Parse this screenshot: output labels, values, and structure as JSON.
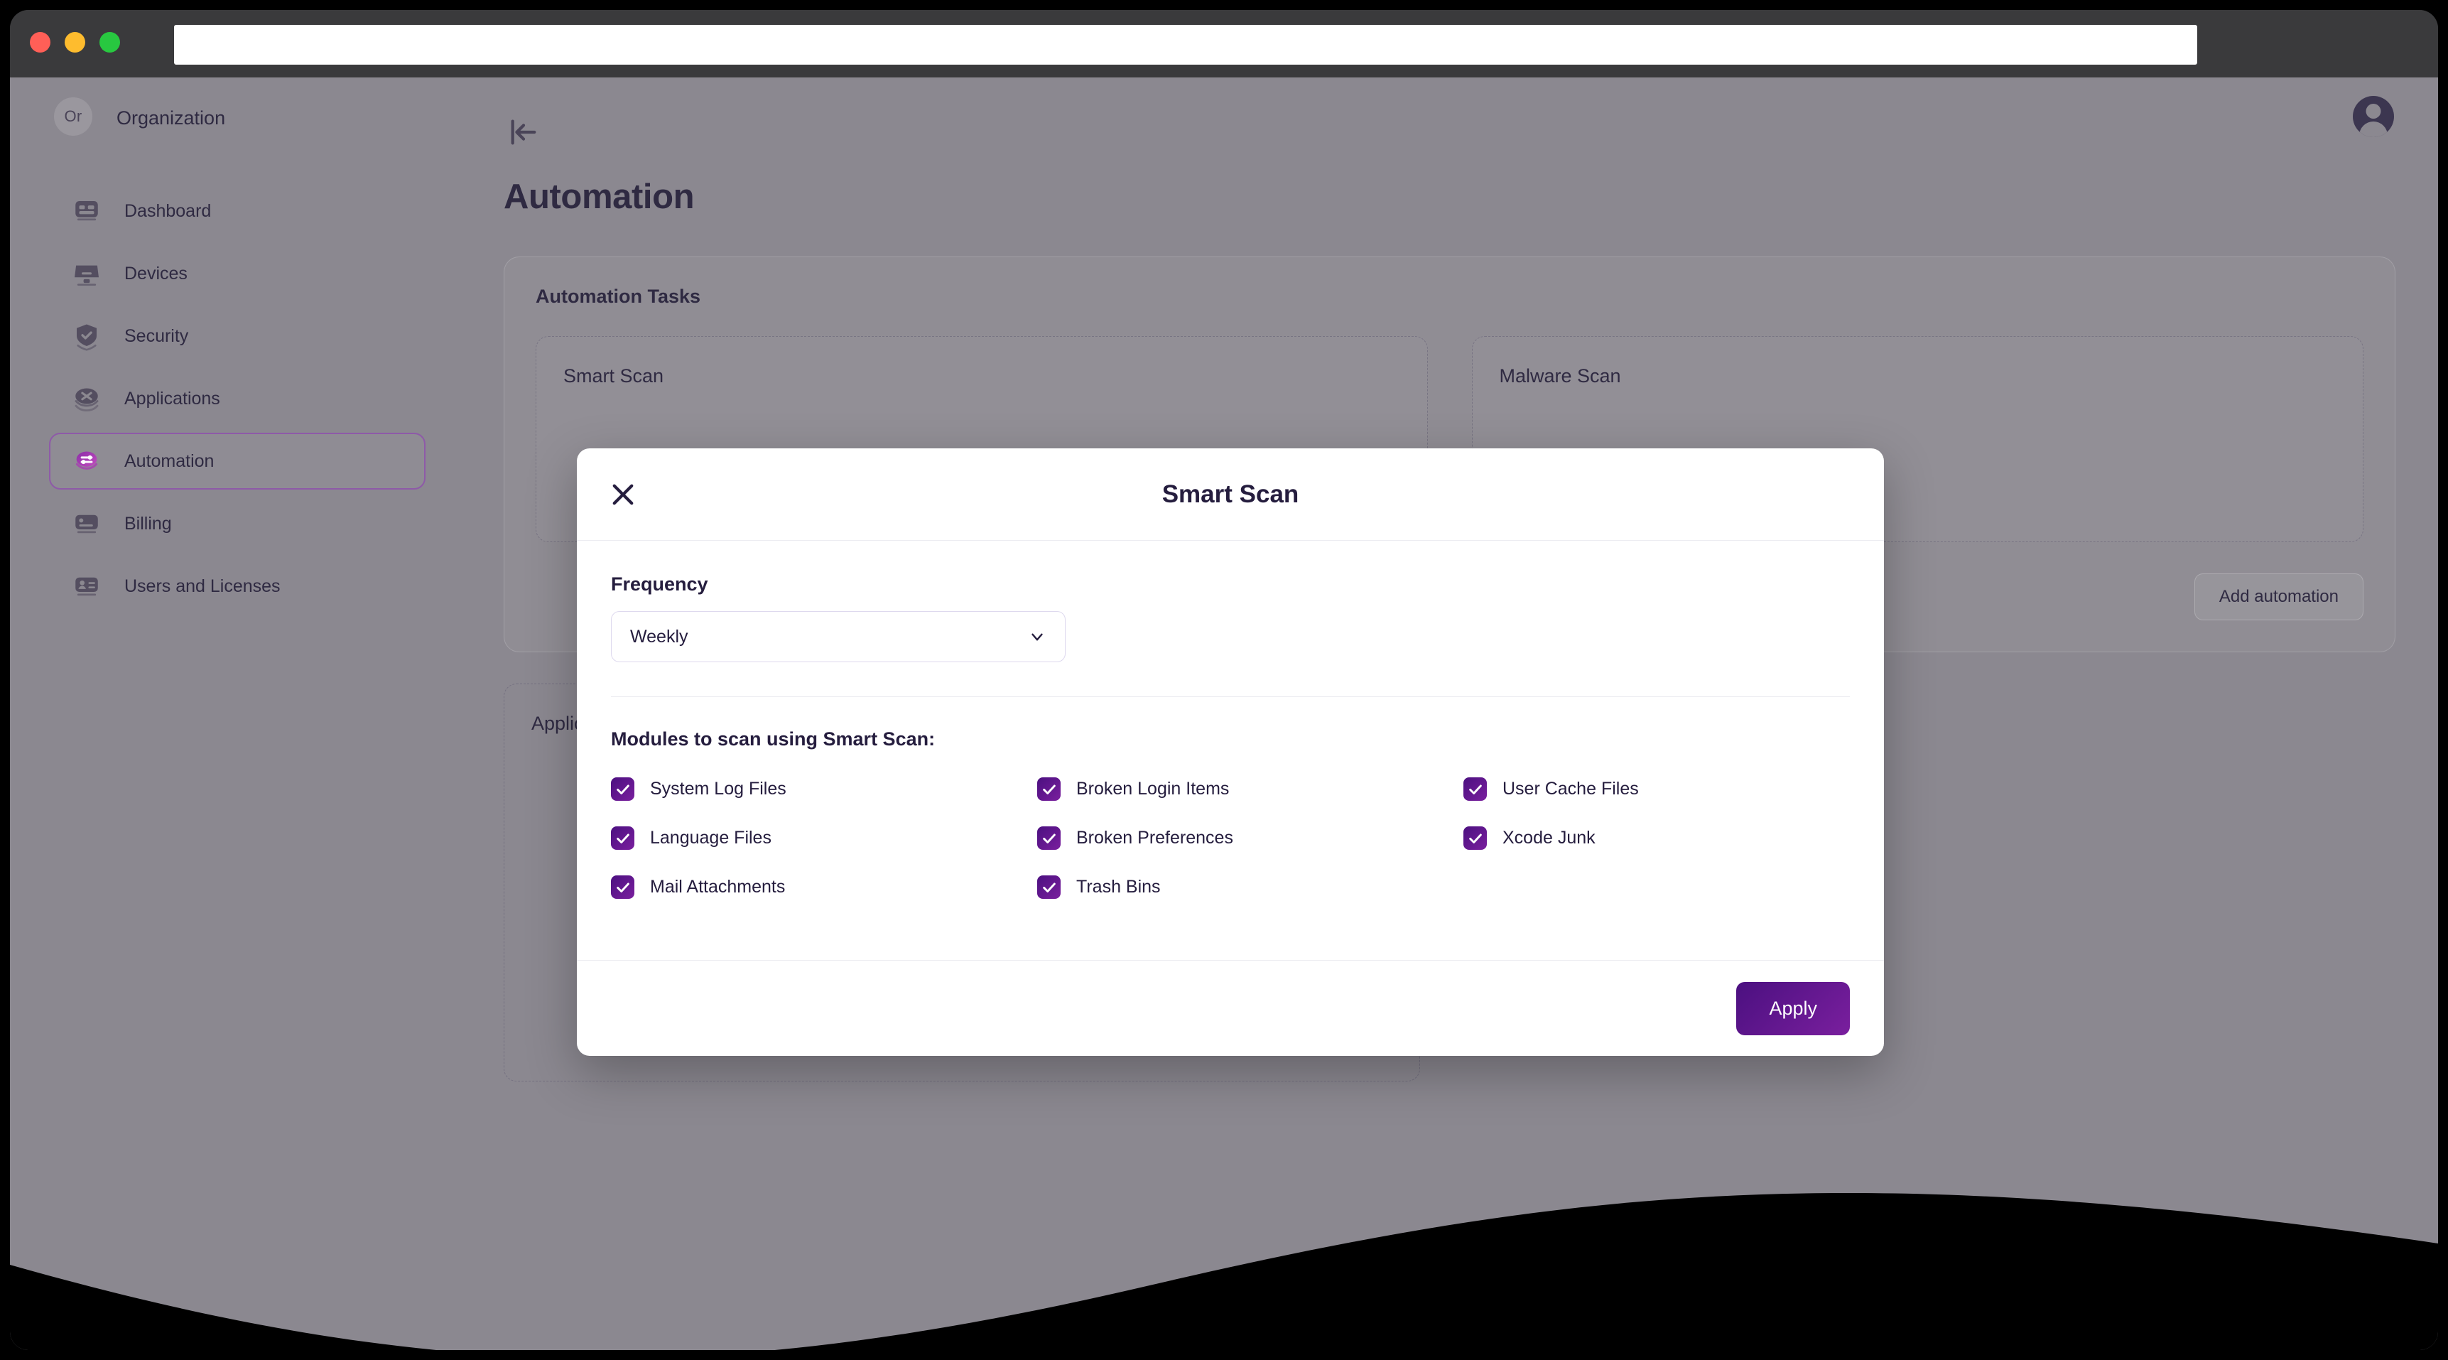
{
  "browser": {
    "traffic_lights": [
      "close",
      "minimize",
      "maximize"
    ],
    "url_value": "",
    "url_placeholder": ""
  },
  "topbar": {
    "org_initials": "Or",
    "org_name": "Organization",
    "collapse_icon": "collapse-sidebar-icon",
    "avatar_icon": "user-avatar-icon"
  },
  "sidebar": {
    "items": [
      {
        "label": "Dashboard",
        "icon": "dashboard-icon",
        "active": false
      },
      {
        "label": "Devices",
        "icon": "monitor-icon",
        "active": false
      },
      {
        "label": "Security",
        "icon": "shield-check-icon",
        "active": false
      },
      {
        "label": "Applications",
        "icon": "apps-icon",
        "active": false
      },
      {
        "label": "Automation",
        "icon": "sliders-icon",
        "active": true
      },
      {
        "label": "Billing",
        "icon": "card-icon",
        "active": false
      },
      {
        "label": "Users and Licenses",
        "icon": "user-card-icon",
        "active": false
      }
    ]
  },
  "main": {
    "page_title": "Automation",
    "panel_title": "Automation Tasks",
    "task_cards": [
      {
        "title": "Smart Scan"
      },
      {
        "title": "Malware Scan"
      }
    ],
    "add_automation_label": "Add automation",
    "apps_card_title": "Applications"
  },
  "modal": {
    "title": "Smart Scan",
    "close_icon": "close-icon",
    "frequency_label": "Frequency",
    "frequency_value": "Weekly",
    "frequency_options": [
      "Weekly"
    ],
    "chevron_icon": "chevron-down-icon",
    "modules_heading": "Modules to scan using Smart Scan:",
    "modules": [
      {
        "label": "System Log Files",
        "checked": true
      },
      {
        "label": "Broken Login Items",
        "checked": true
      },
      {
        "label": "User Cache Files",
        "checked": true
      },
      {
        "label": "Language Files",
        "checked": true
      },
      {
        "label": "Broken Preferences",
        "checked": true
      },
      {
        "label": "Xcode Junk",
        "checked": true
      },
      {
        "label": "Mail Attachments",
        "checked": true
      },
      {
        "label": "Trash Bins",
        "checked": true
      },
      {
        "label": "",
        "checked": false
      }
    ],
    "apply_label": "Apply"
  },
  "colors": {
    "accent_purple": "#4b1080",
    "accent_magenta": "#7a1f9e",
    "active_border": "#8e5aa8",
    "app_background": "#8b8890",
    "modal_text": "#251d3e",
    "titlebar": "#3a3a3c"
  }
}
